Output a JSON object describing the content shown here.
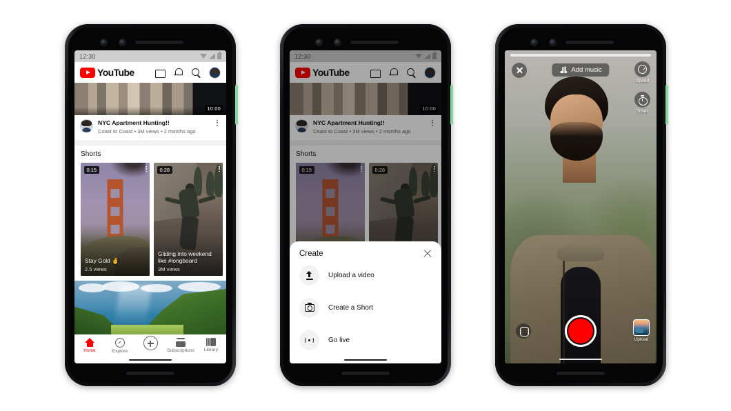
{
  "statusbar": {
    "time": "12:30",
    "icons": [
      "wifi-icon",
      "signal-icon",
      "battery-icon"
    ]
  },
  "header": {
    "brand": "YouTube",
    "actions": [
      {
        "name": "cast-icon",
        "label": "Cast"
      },
      {
        "name": "notifications-bell-icon",
        "label": "Notifications"
      },
      {
        "name": "search-icon",
        "label": "Search"
      },
      {
        "name": "account-avatar",
        "label": "Account"
      }
    ]
  },
  "feed": {
    "hero_video": {
      "duration": "10:00",
      "title": "NYC Apartment Hunting!!",
      "meta": "Coast to Coast • 3M views • 2 months ago",
      "channel": "Coast to Coast",
      "views": "3M views",
      "age": "2 months ago",
      "more_icon": "kebab-menu-icon"
    },
    "shorts": {
      "section_title": "Shorts",
      "cards": [
        {
          "duration": "0:15",
          "title": "Stay Gold ✌",
          "views": "2.5 views"
        },
        {
          "duration": "0:28",
          "title": "Gliding into weekend like #longboard",
          "views": "3M views"
        },
        {
          "duration": "",
          "title": "",
          "views": ""
        }
      ]
    },
    "landscape_thumb": {
      "alt": "tropical valley landscape"
    }
  },
  "bottom_nav": {
    "items": [
      {
        "label": "Home",
        "icon": "home-icon",
        "active": true
      },
      {
        "label": "Explore",
        "icon": "compass-icon",
        "active": false
      },
      {
        "label": "",
        "icon": "create-plus-icon",
        "active": false
      },
      {
        "label": "Subscriptions",
        "icon": "subscriptions-icon",
        "active": false
      },
      {
        "label": "Library",
        "icon": "library-icon",
        "active": false
      }
    ],
    "active_color": "#ff0000",
    "inactive_color": "#606060"
  },
  "create_sheet": {
    "title": "Create",
    "close_icon": "close-icon",
    "items": [
      {
        "label": "Upload a video",
        "icon": "upload-icon"
      },
      {
        "label": "Create a Short",
        "icon": "camera-icon"
      },
      {
        "label": "Go live",
        "icon": "broadcast-live-icon"
      }
    ]
  },
  "camera": {
    "close_icon": "close-icon",
    "add_music_label": "Add music",
    "add_music_icon": "music-note-icon",
    "tools": [
      {
        "label": "Speed",
        "icon": "speed-gauge-icon"
      },
      {
        "label": "Timer",
        "icon": "timer-icon"
      }
    ],
    "flip_icon": "flip-camera-icon",
    "shutter": {
      "name": "record-button",
      "color": "#ff0000"
    },
    "upload": {
      "label": "Upload",
      "icon": "upload-thumbnail"
    }
  },
  "colors": {
    "brand_red": "#ff0000",
    "text_primary": "#0f0f0f",
    "text_secondary": "#606060",
    "statusbar_bg": "#cfcfcf",
    "power_button_green": "#84d6a6"
  }
}
